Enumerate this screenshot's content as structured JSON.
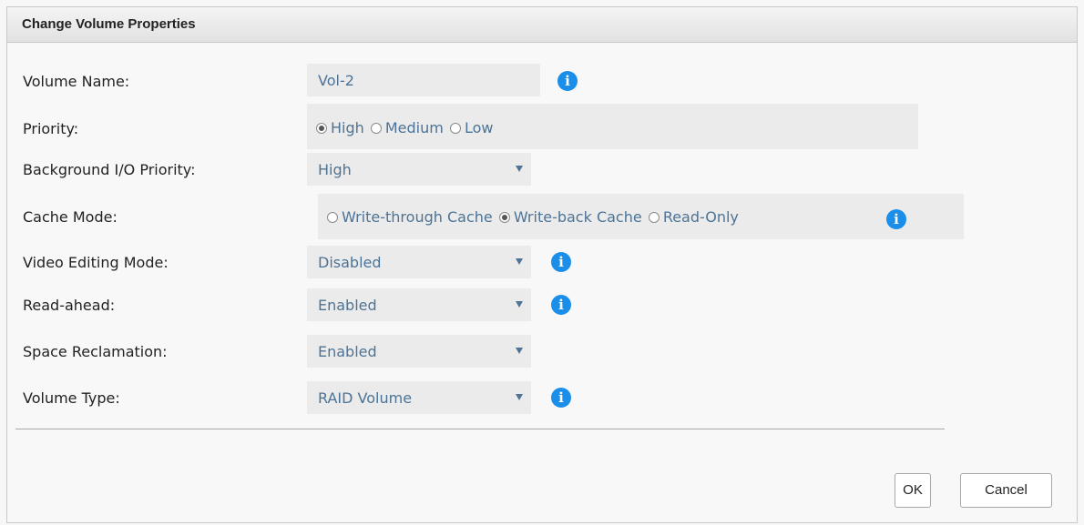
{
  "dialog": {
    "title": "Change Volume Properties"
  },
  "fields": {
    "volume_name": {
      "label": "Volume Name:",
      "value": "Vol-2"
    },
    "priority": {
      "label": "Priority:",
      "options": [
        {
          "label": "High",
          "checked": true
        },
        {
          "label": "Medium",
          "checked": false
        },
        {
          "label": "Low",
          "checked": false
        }
      ]
    },
    "bg_io_priority": {
      "label": "Background I/O Priority:",
      "value": "High"
    },
    "cache_mode": {
      "label": "Cache Mode:",
      "options": [
        {
          "label": "Write-through Cache",
          "checked": false
        },
        {
          "label": "Write-back Cache",
          "checked": true
        },
        {
          "label": "Read-Only",
          "checked": false
        }
      ]
    },
    "video_editing": {
      "label": "Video Editing Mode:",
      "value": "Disabled"
    },
    "read_ahead": {
      "label": "Read-ahead:",
      "value": "Enabled"
    },
    "space_reclamation": {
      "label": "Space Reclamation:",
      "value": "Enabled"
    },
    "volume_type": {
      "label": "Volume Type:",
      "value": "RAID Volume"
    }
  },
  "buttons": {
    "ok": "OK",
    "cancel": "Cancel"
  },
  "icons": {
    "info": "info-icon",
    "info_glyph": "i",
    "dropdown": "dropdown-arrow-icon"
  },
  "colors": {
    "field_bg": "#ebebeb",
    "field_text": "#4d7396",
    "info": "#1a8ee8"
  }
}
